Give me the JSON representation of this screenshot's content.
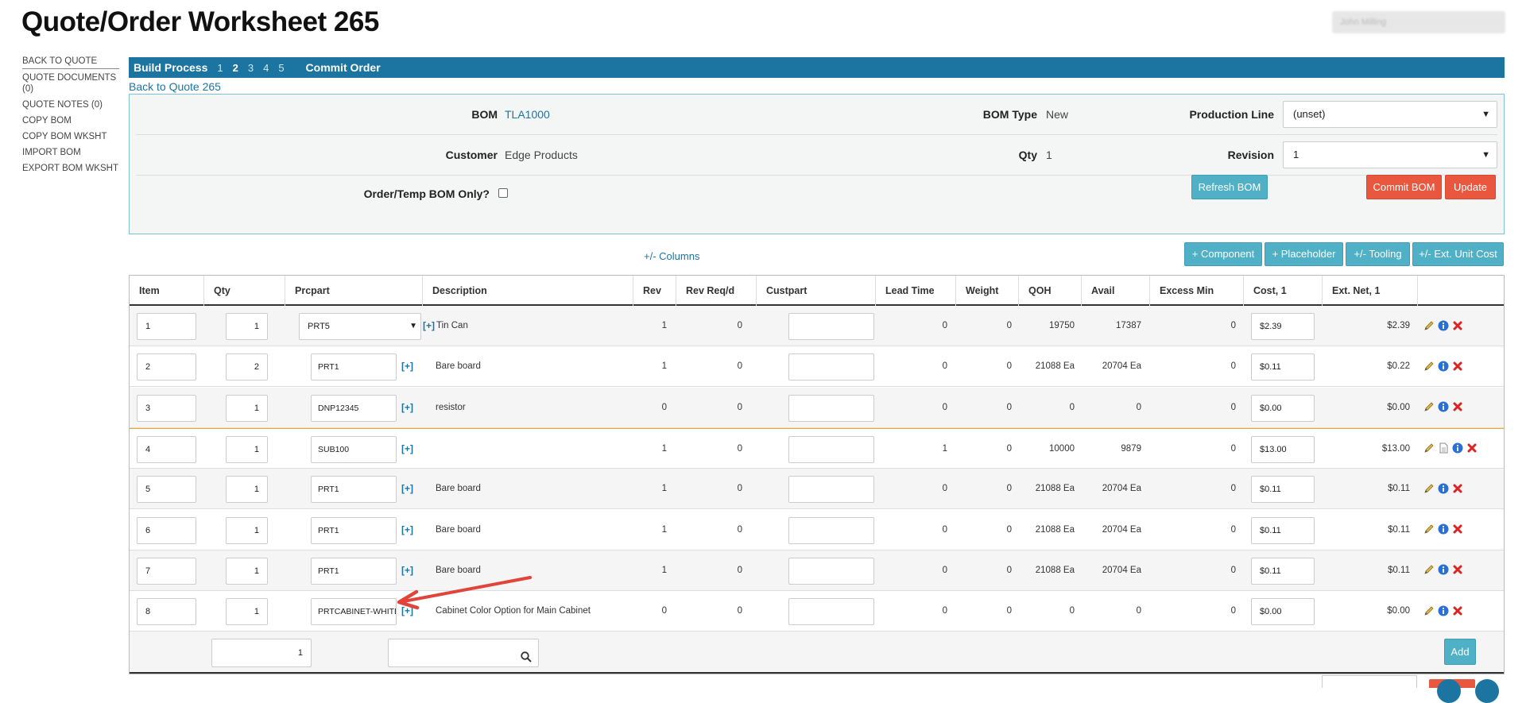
{
  "page": {
    "title": "Quote/Order Worksheet 265",
    "user_box": "John Milling"
  },
  "sidebar": {
    "items": [
      {
        "label": "BACK TO QUOTE"
      },
      {
        "label": "QUOTE DOCUMENTS (0)"
      },
      {
        "label": "QUOTE NOTES (0)"
      },
      {
        "label": "COPY BOM"
      },
      {
        "label": "COPY BOM WKSHT"
      },
      {
        "label": "IMPORT BOM"
      },
      {
        "label": "EXPORT BOM WKSHT"
      }
    ]
  },
  "build_bar": {
    "title": "Build Process",
    "steps": [
      "1",
      "2",
      "3",
      "4",
      "5"
    ],
    "current_step": "2",
    "commit": "Commit Order"
  },
  "back_link": "Back to Quote 265",
  "header": {
    "bom_label": "BOM",
    "bom_value": "TLA1000",
    "bom_type_label": "BOM Type",
    "bom_type_value": "New",
    "production_line_label": "Production Line",
    "production_line_value": "(unset)",
    "customer_label": "Customer",
    "customer_value": "Edge Products",
    "qty_label": "Qty",
    "qty_value": "1",
    "revision_label": "Revision",
    "revision_value": "1",
    "temp_bom_label": "Order/Temp BOM Only?",
    "refresh_button": "Refresh BOM",
    "commit_button": "Commit BOM",
    "update_button": "Update"
  },
  "toolbar": {
    "columns_link": "+/- Columns",
    "component_button": "+ Component",
    "placeholder_button": "+ Placeholder",
    "tooling_button": "+/- Tooling",
    "ext_cost_button": "+/- Ext. Unit Cost"
  },
  "table": {
    "columns": [
      "Item",
      "Qty",
      "Prcpart",
      "Description",
      "Rev",
      "Rev Req/d",
      "Custpart",
      "Lead Time",
      "Weight",
      "QOH",
      "Avail",
      "Excess Min",
      "Cost, 1",
      "Ext. Net, 1"
    ],
    "rows": [
      {
        "item": "1",
        "qty": "1",
        "prcpart": "PRT5",
        "description": "Tin Can",
        "rev": "1",
        "rev_reqd": "0",
        "custpart": "",
        "lead_time": "0",
        "weight": "0",
        "qoh": "19750",
        "avail": "17387",
        "excess_min": "0",
        "cost": "$2.39",
        "ext_net": "$2.39"
      },
      {
        "item": "2",
        "qty": "2",
        "prcpart": "PRT1",
        "description": "Bare board",
        "rev": "1",
        "rev_reqd": "0",
        "custpart": "",
        "lead_time": "0",
        "weight": "0",
        "qoh": "21088 Ea",
        "avail": "20704 Ea",
        "excess_min": "0",
        "cost": "$0.11",
        "ext_net": "$0.22"
      },
      {
        "item": "3",
        "qty": "1",
        "prcpart": "DNP12345",
        "description": "resistor",
        "rev": "0",
        "rev_reqd": "0",
        "custpart": "",
        "lead_time": "0",
        "weight": "0",
        "qoh": "0",
        "avail": "0",
        "excess_min": "0",
        "cost": "$0.00",
        "ext_net": "$0.00"
      },
      {
        "item": "4",
        "qty": "1",
        "prcpart": "SUB100",
        "description": "",
        "rev": "1",
        "rev_reqd": "0",
        "custpart": "",
        "lead_time": "1",
        "weight": "0",
        "qoh": "10000",
        "avail": "9879",
        "excess_min": "0",
        "cost": "$13.00",
        "ext_net": "$13.00"
      },
      {
        "item": "5",
        "qty": "1",
        "prcpart": "PRT1",
        "description": "Bare board",
        "rev": "1",
        "rev_reqd": "0",
        "custpart": "",
        "lead_time": "0",
        "weight": "0",
        "qoh": "21088 Ea",
        "avail": "20704 Ea",
        "excess_min": "0",
        "cost": "$0.11",
        "ext_net": "$0.11"
      },
      {
        "item": "6",
        "qty": "1",
        "prcpart": "PRT1",
        "description": "Bare board",
        "rev": "1",
        "rev_reqd": "0",
        "custpart": "",
        "lead_time": "0",
        "weight": "0",
        "qoh": "21088 Ea",
        "avail": "20704 Ea",
        "excess_min": "0",
        "cost": "$0.11",
        "ext_net": "$0.11"
      },
      {
        "item": "7",
        "qty": "1",
        "prcpart": "PRT1",
        "description": "Bare board",
        "rev": "1",
        "rev_reqd": "0",
        "custpart": "",
        "lead_time": "0",
        "weight": "0",
        "qoh": "21088 Ea",
        "avail": "20704 Ea",
        "excess_min": "0",
        "cost": "$0.11",
        "ext_net": "$0.11"
      },
      {
        "item": "8",
        "qty": "1",
        "prcpart": "PRTCABINET-WHITE",
        "description": "Cabinet Color Option for Main Cabinet",
        "rev": "0",
        "rev_reqd": "0",
        "custpart": "",
        "lead_time": "0",
        "weight": "0",
        "qoh": "0",
        "avail": "0",
        "excess_min": "0",
        "cost": "$0.00",
        "ext_net": "$0.00"
      }
    ],
    "plus_label": "[+]",
    "new_row_qty": "1",
    "add_button": "Add"
  },
  "colors": {
    "brand_blue": "#1c75a0",
    "button_blue": "#4fb0c6",
    "button_red": "#e9573f",
    "annotation_arrow": "#e0443a"
  }
}
